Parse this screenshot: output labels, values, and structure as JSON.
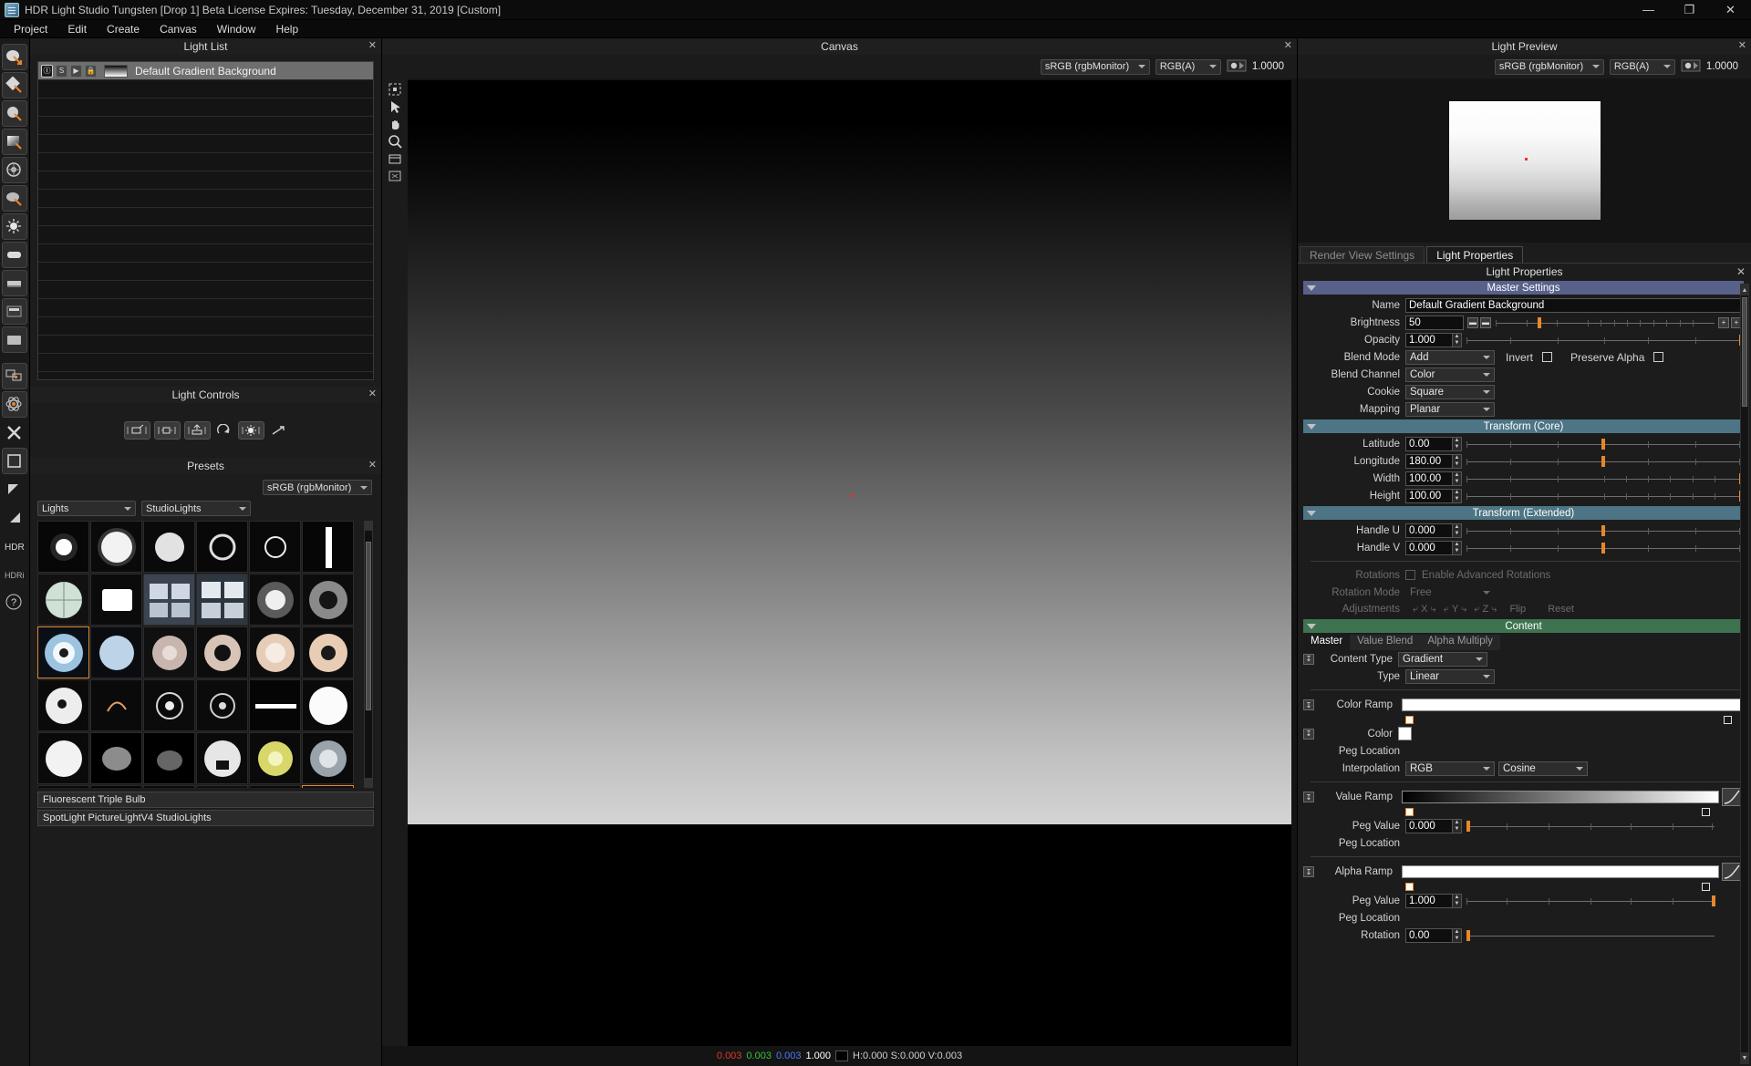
{
  "window": {
    "title": "HDR Light Studio Tungsten [Drop 1] Beta License Expires: Tuesday, December 31, 2019  [Custom]",
    "minimize": "—",
    "maximize": "❐",
    "close": "✕"
  },
  "menu": [
    "Project",
    "Edit",
    "Create",
    "Canvas",
    "Window",
    "Help"
  ],
  "light_list": {
    "panel_title": "Light List",
    "close": "✕",
    "rows": [
      {
        "name": "Default Gradient Background",
        "buttons": [
          "Ⓘ",
          "S",
          "▶",
          "ὑ2"
        ],
        "selected": true
      }
    ]
  },
  "light_controls": {
    "panel_title": "Light Controls",
    "close": "✕"
  },
  "presets": {
    "panel_title": "Presets",
    "close": "✕",
    "colorspace": "sRGB (rgbMonitor)",
    "filter_category": "Lights",
    "filter_set": "StudioLights",
    "footer_line1": "Fluorescent Triple Bulb",
    "footer_line2": "SpotLight PictureLightV4 StudioLights"
  },
  "canvas": {
    "panel_title": "Canvas",
    "close": "✕",
    "colorspace": "sRGB (rgbMonitor)",
    "channel": "RGB(A)",
    "exposure": "1.0000",
    "status": {
      "r": "0.003",
      "g": "0.003",
      "b": "0.003",
      "a": "1.000",
      "hsv": "H:0.000 S:0.000 V:0.003"
    }
  },
  "light_preview": {
    "panel_title": "Light Preview",
    "close": "✕",
    "colorspace": "sRGB (rgbMonitor)",
    "channel": "RGB(A)",
    "exposure": "1.0000"
  },
  "properties": {
    "tabs": [
      {
        "label": "Render View Settings",
        "active": false
      },
      {
        "label": "Light Properties",
        "active": true
      }
    ],
    "title": "Light Properties",
    "close": "✕",
    "sections": {
      "master": "Master Settings",
      "core": "Transform (Core)",
      "extended": "Transform (Extended)",
      "content": "Content"
    },
    "master": {
      "name_label": "Name",
      "name_value": "Default Gradient Background",
      "brightness_label": "Brightness",
      "brightness_value": "50",
      "opacity_label": "Opacity",
      "opacity_value": "1.000",
      "blend_mode_label": "Blend Mode",
      "blend_mode_value": "Add",
      "invert_label": "Invert",
      "preserve_alpha_label": "Preserve Alpha",
      "blend_channel_label": "Blend Channel",
      "blend_channel_value": "Color",
      "cookie_label": "Cookie",
      "cookie_value": "Square",
      "mapping_label": "Mapping",
      "mapping_value": "Planar",
      "minus_big": "➖",
      "minus_small": "➖",
      "plus_small": "➕",
      "plus_big": "➕"
    },
    "core": {
      "latitude_label": "Latitude",
      "latitude_value": "0.00",
      "longitude_label": "Longitude",
      "longitude_value": "180.00",
      "width_label": "Width",
      "width_value": "100.00",
      "height_label": "Height",
      "height_value": "100.00"
    },
    "extended": {
      "handle_u_label": "Handle U",
      "handle_u_value": "0.000",
      "handle_v_label": "Handle V",
      "handle_v_value": "0.000",
      "rotations_label": "Rotations",
      "enable_advanced_rotations_label": "Enable Advanced Rotations",
      "rotation_mode_label": "Rotation Mode",
      "rotation_mode_value": "Free",
      "adjustments_label": "Adjustments",
      "axis_x": "X",
      "axis_y": "Y",
      "axis_z": "Z",
      "flip_label": "Flip",
      "reset_label": "Reset"
    },
    "content": {
      "subtabs": [
        {
          "label": "Master",
          "active": true
        },
        {
          "label": "Value Blend",
          "active": false
        },
        {
          "label": "Alpha Multiply",
          "active": false
        }
      ],
      "content_type_label": "Content Type",
      "content_type_value": "Gradient",
      "type_label": "Type",
      "type_value": "Linear",
      "color_ramp_label": "Color Ramp",
      "color_label": "Color",
      "peg_location_label": "Peg Location",
      "interpolation_label": "Interpolation",
      "interpolation_space": "RGB",
      "interpolation_curve": "Cosine",
      "value_ramp_label": "Value Ramp",
      "value_peg_value_label": "Peg Value",
      "value_peg_value": "0.000",
      "value_peg_location_label": "Peg Location",
      "alpha_ramp_label": "Alpha Ramp",
      "alpha_peg_value_label": "Peg Value",
      "alpha_peg_value": "1.000",
      "alpha_peg_location_label": "Peg Location",
      "rotation_label": "Rotation",
      "rotation_value": "0.00"
    }
  },
  "colors": {
    "accent_orange": "#e8872a",
    "section_master": "#57618a",
    "section_transform": "#4d7585",
    "section_content": "#3e7350"
  }
}
